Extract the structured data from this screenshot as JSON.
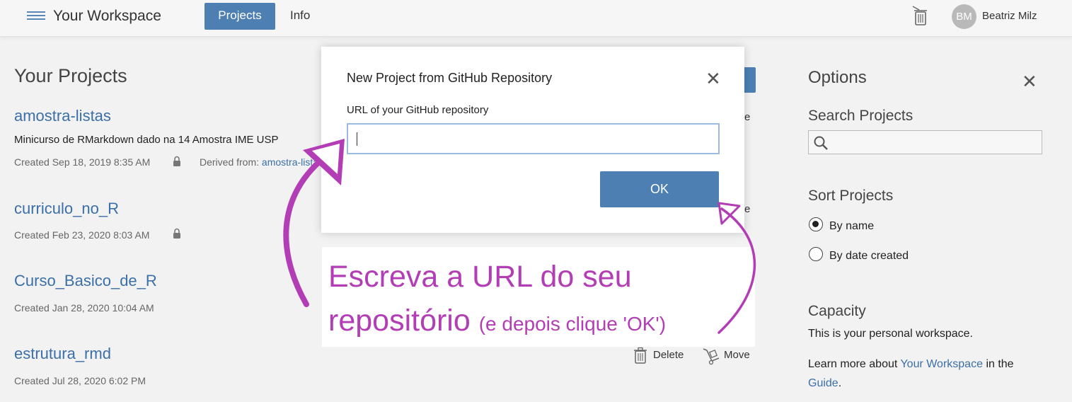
{
  "header": {
    "app_title": "Your Workspace",
    "nav_projects": "Projects",
    "nav_info": "Info",
    "avatar_initials": "BM",
    "user_name": "Beatriz Milz"
  },
  "projects": {
    "heading": "Your Projects",
    "items": [
      {
        "name": "amostra-listas",
        "description": "Minicurso de RMarkdown dado na 14 Amostra IME USP",
        "created": "Created Sep 18, 2019 8:35 AM",
        "derived_label": "Derived from:",
        "derived_link": "amostra-lista"
      },
      {
        "name": "curriculo_no_R",
        "created": "Created Feb 23, 2020 8:03 AM"
      },
      {
        "name": "Curso_Basico_de_R",
        "created": "Created Jan 28, 2020 10:04 AM"
      },
      {
        "name": "estrutura_rmd",
        "created": "Created Jul 28, 2020 6:02 PM"
      }
    ],
    "delete_label": "Delete",
    "move_label": "Move",
    "hidden_fragment_1": "e",
    "hidden_fragment_2": "e"
  },
  "options": {
    "title": "Options",
    "close": "✕",
    "search_heading": "Search Projects",
    "sort_heading": "Sort Projects",
    "sort_by_name": "By name",
    "sort_by_date": "By date created",
    "sort_selected": "By name",
    "capacity_heading": "Capacity",
    "capacity_text": "This is your personal workspace.",
    "learn_prefix": "Learn more about",
    "learn_link": "Your Workspace",
    "learn_middle": "in the",
    "guide_link": "Guide",
    "guide_suffix": "."
  },
  "modal": {
    "title": "New Project from GitHub Repository",
    "close": "✕",
    "url_label": "URL of your GitHub repository",
    "url_value": "",
    "ok_label": "OK"
  },
  "annotation": {
    "line1": "Escreva a URL do seu",
    "line2_main": "repositório",
    "line2_small": "(e depois clique 'OK')",
    "color": "#b33db5"
  },
  "colors": {
    "accent": "#4d7fb3",
    "link": "#3c6fa8"
  }
}
